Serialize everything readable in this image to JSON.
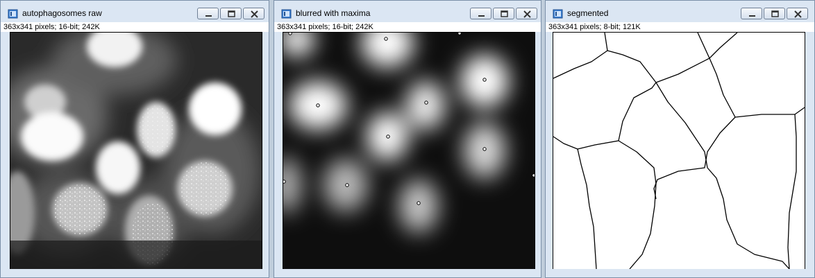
{
  "windows": [
    {
      "title": "autophagosomes raw",
      "info": "363x341 pixels; 16-bit; 242K"
    },
    {
      "title": "blurred with maxima",
      "info": "363x341 pixels; 16-bit; 242K"
    },
    {
      "title": "segmented",
      "info": "363x341 pixels; 8-bit; 121K"
    }
  ],
  "window_controls": [
    "minimize",
    "maximize",
    "close"
  ],
  "colors": {
    "titlebar": "#dbe6f3",
    "desktop": "#bfcddb",
    "frame_border": "#7a8fa8"
  },
  "icons": [
    "imagej-window-icon",
    "minimize-icon",
    "maximize-icon",
    "close-icon"
  ]
}
